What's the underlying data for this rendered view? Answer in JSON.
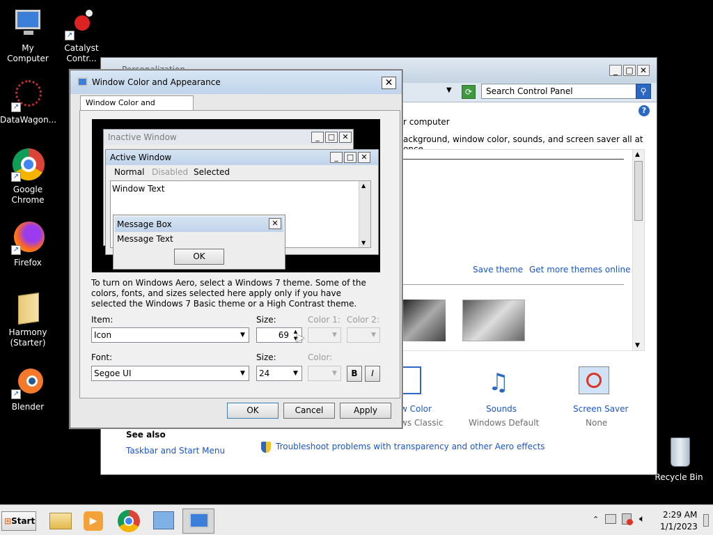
{
  "desktop": {
    "icons": [
      {
        "label": "My Computer"
      },
      {
        "label": "Catalyst Contr..."
      },
      {
        "label": "DataWagon..."
      },
      {
        "label": "Google Chrome"
      },
      {
        "label": "Firefox"
      },
      {
        "label": "Harmony (Starter)"
      },
      {
        "label": "Blender"
      },
      {
        "label": "Recycle Bin"
      }
    ]
  },
  "personalization": {
    "title": "Personalization",
    "search_placeholder": "Search Control Panel",
    "heading_fragment": "r computer",
    "desc_fragment": "ackground, window color, sounds, and screen saver all at once.",
    "save_theme": "Save theme",
    "more_themes": "Get more themes online",
    "window_color_label": "w Color",
    "window_color_value": "ws Classic",
    "sounds_label": "Sounds",
    "sounds_value": "Windows Default",
    "screensaver_label": "Screen Saver",
    "screensaver_value": "None",
    "see_also": "See also",
    "taskbar_link": "Taskbar and Start Menu",
    "troubleshoot_link": "Troubleshoot problems with transparency and other Aero effects"
  },
  "dialog": {
    "title": "Window Color and Appearance",
    "tab": "Window Color and Appearance",
    "preview": {
      "inactive": "Inactive Window",
      "active": "Active Window",
      "menu_normal": "Normal",
      "menu_disabled": "Disabled",
      "menu_selected": "Selected",
      "window_text": "Window Text",
      "msgbox_title": "Message Box",
      "msgbox_text": "Message Text",
      "ok": "OK"
    },
    "info": "To turn on Windows Aero, select a Windows 7 theme.  Some of the colors, fonts, and sizes selected here apply only if you have selected the Windows 7 Basic theme or a High Contrast theme.",
    "item_label": "Item:",
    "item_value": "Icon",
    "size_label": "Size:",
    "size_value": "69",
    "color1_label": "Color 1:",
    "color2_label": "Color 2:",
    "font_label": "Font:",
    "font_value": "Segoe UI",
    "font_size_label": "Size:",
    "font_size_value": "24",
    "color_label": "Color:",
    "bold": "B",
    "italic": "I",
    "ok": "OK",
    "cancel": "Cancel",
    "apply": "Apply"
  },
  "taskbar": {
    "start": "Start",
    "time": "2:29 AM",
    "date": "1/1/2023"
  },
  "colors": {
    "accent": "#1a56c8",
    "title_gradient_top": "#d8e6f4",
    "desktop": "#000000"
  }
}
